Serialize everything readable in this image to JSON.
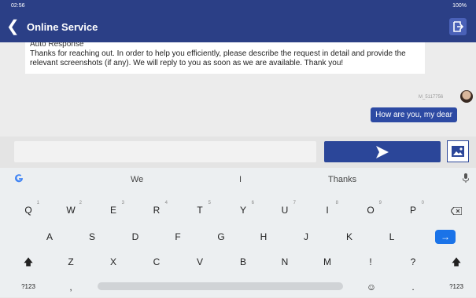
{
  "status": {
    "time": "02:56",
    "battery": "100%"
  },
  "appbar": {
    "back_icon": "chevron-left-icon",
    "title": "Online Service",
    "exit_icon": "exit-icon"
  },
  "chat": {
    "auto_header": "Auto Response",
    "auto_body": "Thanks for reaching out. In order to help you efficiently, please describe the request in detail and provide the relevant screenshots (if any). We will reply to you as soon as we are available. Thank you!",
    "user_id": "M_5117756",
    "user_message": "How are you, my dear"
  },
  "input": {
    "value": "",
    "send_icon": "send-icon",
    "image_icon": "image-icon"
  },
  "keyboard": {
    "suggestions": [
      "We",
      "I",
      "Thanks"
    ],
    "row1": [
      "Q",
      "W",
      "E",
      "R",
      "T",
      "Y",
      "U",
      "I",
      "O",
      "P"
    ],
    "row1_hints": [
      "1",
      "2",
      "3",
      "4",
      "5",
      "6",
      "7",
      "8",
      "9",
      "0"
    ],
    "row2": [
      "A",
      "S",
      "D",
      "F",
      "G",
      "H",
      "J",
      "K",
      "L"
    ],
    "row3": [
      "Z",
      "X",
      "C",
      "V",
      "B",
      "N",
      "M",
      "!",
      "?"
    ],
    "sym_label": "?123",
    "comma": ",",
    "period": "."
  },
  "colors": {
    "brand": "#2b3f86",
    "bubble": "#2d4aa3",
    "enter": "#1a73e8"
  }
}
